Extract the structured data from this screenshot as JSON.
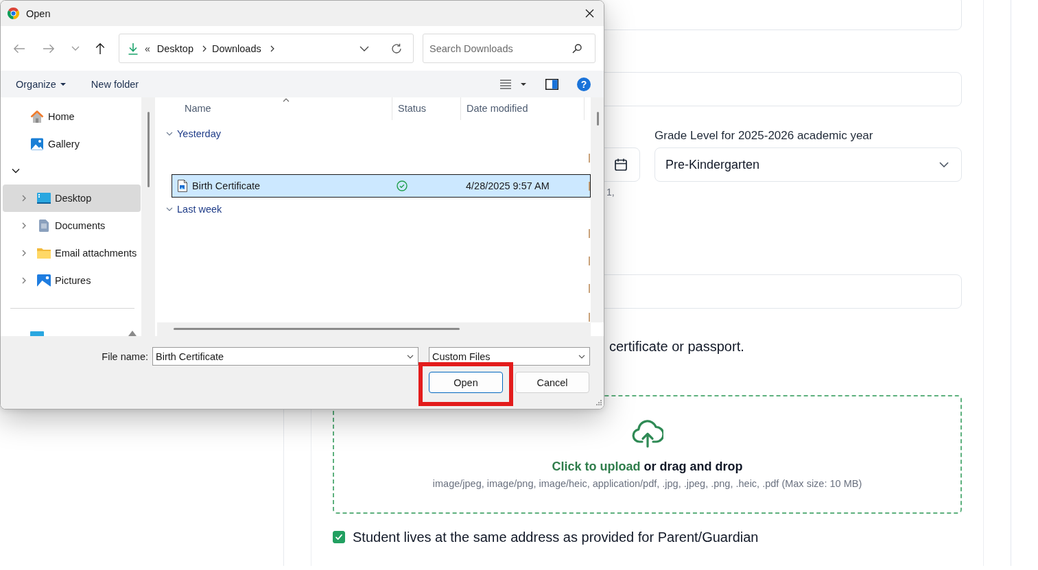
{
  "dialog": {
    "title": "Open",
    "nav_buttons": [
      {
        "kind": "back",
        "disabled": true
      },
      {
        "kind": "forward",
        "disabled": true
      },
      {
        "kind": "recent",
        "disabled": true
      },
      {
        "kind": "up",
        "disabled": false
      }
    ],
    "address": {
      "overflow": "«",
      "crumbs": [
        "Desktop",
        "Downloads"
      ]
    },
    "search": {
      "placeholder": "Search Downloads"
    },
    "toolbar": {
      "organize": "Organize",
      "new_folder": "New folder",
      "help": "?"
    },
    "nav_pane": {
      "quick": [
        {
          "kind": "home",
          "label": "Home",
          "selected": false
        },
        {
          "kind": "gallery",
          "label": "Gallery",
          "selected": false
        }
      ],
      "section": {
        "expanded": true,
        "children": [
          {
            "kind": "desktop",
            "label": "Desktop",
            "selected": true,
            "expanded": false
          },
          {
            "kind": "documents",
            "label": "Documents",
            "selected": false,
            "expanded": false
          },
          {
            "kind": "folder",
            "label": "Email attachments",
            "selected": false,
            "expanded": false
          },
          {
            "kind": "pictures",
            "label": "Pictures",
            "selected": false,
            "expanded": false
          }
        ]
      },
      "lower": [
        {
          "kind": "desktop",
          "selected": false
        }
      ]
    },
    "file_list": {
      "columns": [
        {
          "label": "Name",
          "sorted": true
        },
        {
          "label": "Status",
          "sorted": false
        },
        {
          "label": "Date modified",
          "sorted": false
        }
      ],
      "groups": [
        {
          "label": "Yesterday",
          "expanded": true,
          "files": [
            {
              "name": "Birth Certificate",
              "synced": true,
              "date": "4/28/2025 9:57 AM",
              "selected": true
            }
          ]
        },
        {
          "label": "Last week",
          "expanded": true
        }
      ]
    },
    "file_name": {
      "label": "File name:",
      "value": "Birth Certificate"
    },
    "file_type": {
      "value": "Custom Files"
    },
    "buttons": [
      {
        "label": "Open",
        "default": true,
        "highlighted": true
      },
      {
        "label": "Cancel",
        "default": false,
        "highlighted": false
      }
    ]
  },
  "form": {
    "items": [
      {
        "kind": "field"
      },
      {
        "kind": "field"
      },
      {
        "kind": "date-and-grade",
        "grade_label": "Grade Level for 2025-2026 academic year",
        "grade_value": "Pre-Kindergarten",
        "hint": "1,"
      },
      {
        "kind": "field"
      },
      {
        "kind": "text",
        "text": "certificate or passport."
      },
      {
        "kind": "upload",
        "link": "Click to upload",
        "prompt": "or drag and drop",
        "formats": "image/jpeg, image/png, image/heic, application/pdf, .jpg, .jpeg, .png, .heic, .pdf (Max size: 10 MB)"
      },
      {
        "kind": "checkbox",
        "label": "Student lives at the same address as provided for Parent/Guardian",
        "checked": true
      }
    ]
  }
}
